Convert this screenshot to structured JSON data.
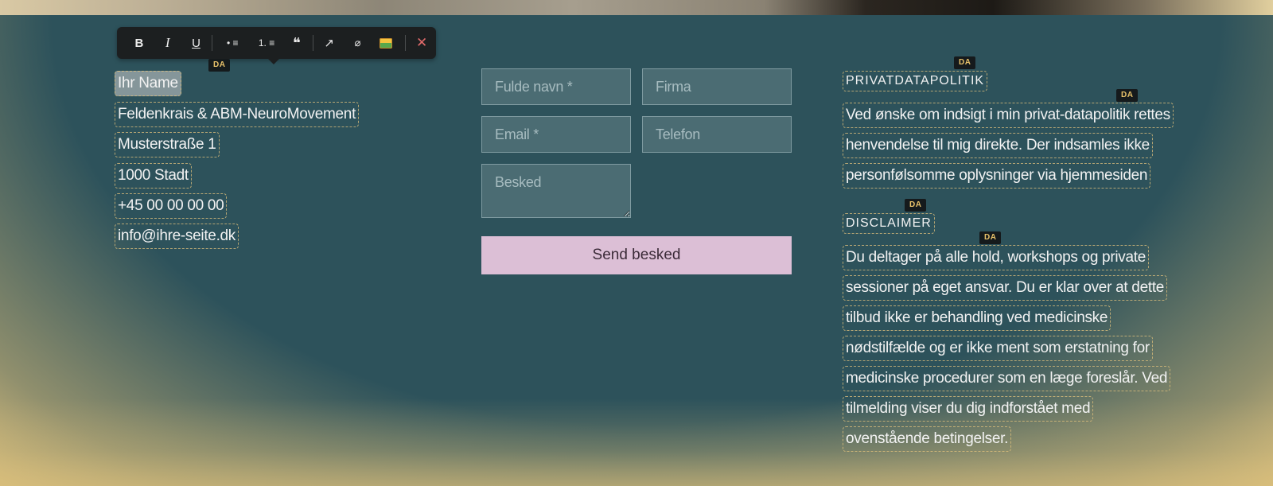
{
  "toolbar": {
    "bold_label": "B",
    "italic_label": "I",
    "underline_label": "U",
    "bullet_list_label": "• ≡",
    "numbered_list_label": "1. ≡",
    "quote_label": "❝",
    "link_label": "↗",
    "unlink_label": "⌀",
    "close_label": "✕",
    "icons": [
      "bold-icon",
      "italic-icon",
      "underline-icon",
      "bullet-list-icon",
      "numbered-list-icon",
      "quote-icon",
      "link-icon",
      "unlink-icon",
      "image-icon",
      "close-icon"
    ]
  },
  "language_badge": "DA",
  "contact": {
    "name": "Ihr Name",
    "business": "Feldenkrais & ABM-NeuroMovement",
    "street": "Musterstraße 1",
    "city": "1000 Stadt",
    "phone": "+45 00 00 00 00",
    "email": "info@ihre-seite.dk"
  },
  "form": {
    "full_name_placeholder": "Fulde navn *",
    "company_placeholder": "Firma",
    "email_placeholder": "Email *",
    "phone_placeholder": "Telefon",
    "message_placeholder": "Besked",
    "submit_label": "Send besked"
  },
  "privacy": {
    "heading": "PRIVATDATAPOLITIK",
    "lines": [
      "Ved ønske om indsigt i min privat-datapolitik rettes",
      "henvendelse til mig direkte. Der indsamles ikke",
      "personfølsomme oplysninger via hjemmesiden"
    ]
  },
  "disclaimer": {
    "heading": "DISCLAIMER",
    "lines": [
      "Du deltager på alle hold, workshops og private",
      "sessioner på eget ansvar. Du er klar over at dette",
      "tilbud ikke er behandling ved medicinske",
      "nødstilfælde og er ikke ment som erstatning for",
      "medicinske procedurer som en læge foreslår. Ved",
      "tilmelding viser du dig indforstået med",
      "ovenstående betingelser."
    ]
  },
  "colors": {
    "background": "#2d525b",
    "frame": "#e2c27c",
    "button": "#dcbfd6",
    "toolbar": "#1c1f20",
    "badge_text": "#e8c26a"
  }
}
